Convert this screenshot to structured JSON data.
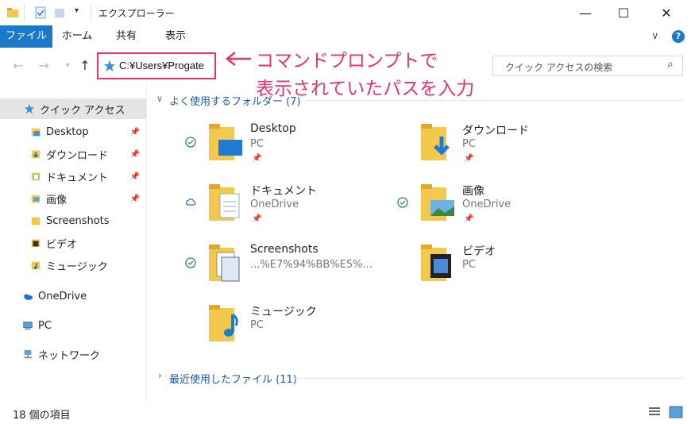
{
  "window": {
    "title": "エクスプローラー",
    "minimize": "—",
    "maximize": "☐",
    "close": "✕"
  },
  "ribbon": {
    "tabs": [
      "ファイル",
      "ホーム",
      "共有",
      "表示"
    ]
  },
  "address": {
    "path": "C:¥Users¥Progate"
  },
  "search": {
    "placeholder": "クイック アクセスの検索"
  },
  "annotation": {
    "line1": "コマンドプロンプトで",
    "line2": "表示されていたパスを入力",
    "color": "#e8336b"
  },
  "nav": {
    "quick_access": "クイック アクセス",
    "items": [
      "Desktop",
      "ダウンロード",
      "ドキュメント",
      "画像",
      "Screenshots",
      "ビデオ",
      "ミュージック"
    ],
    "onedrive": "OneDrive",
    "pc": "PC",
    "network": "ネットワーク"
  },
  "content": {
    "frequent_header": "よく使用するフォルダー (7)",
    "recent_header": "最近使用したファイル (11)",
    "folders": [
      {
        "name": "Desktop",
        "sub": "PC"
      },
      {
        "name": "ダウンロード",
        "sub": "PC"
      },
      {
        "name": "ドキュメント",
        "sub": "OneDrive"
      },
      {
        "name": "画像",
        "sub": "OneDrive"
      },
      {
        "name": "Screenshots",
        "sub": "...%E7%94%BB%E5%..."
      },
      {
        "name": "ビデオ",
        "sub": "PC"
      },
      {
        "name": "ミュージック",
        "sub": "PC"
      }
    ]
  },
  "status": {
    "count": "18 個の項目"
  }
}
